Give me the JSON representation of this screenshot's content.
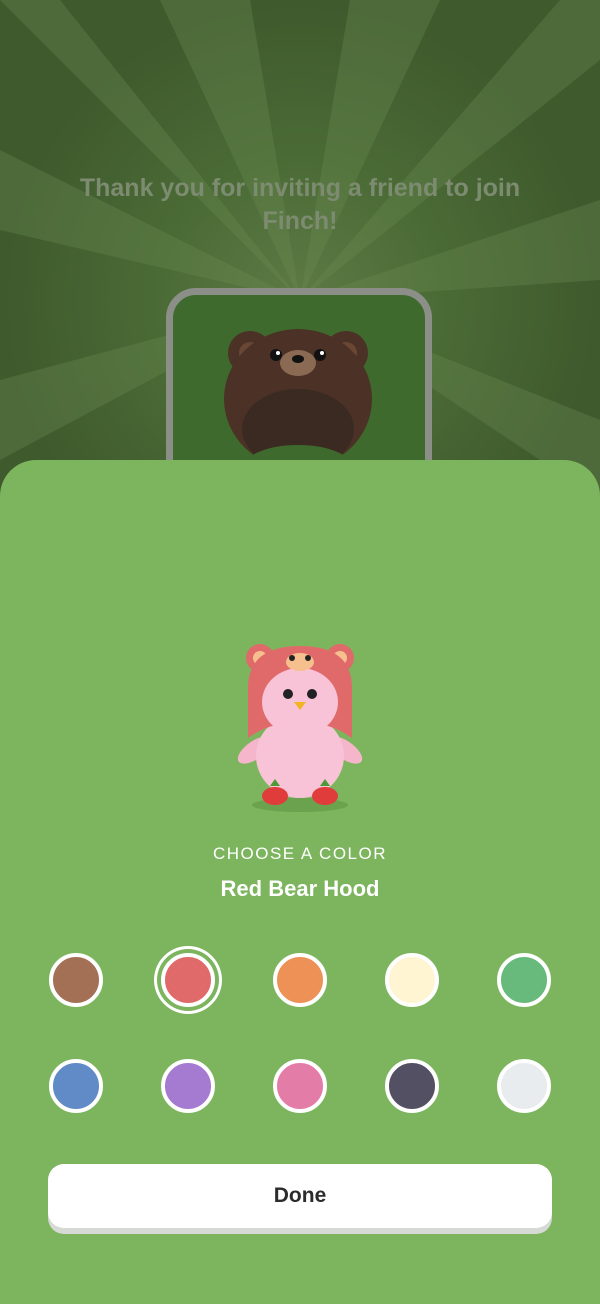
{
  "header": {
    "message": "Thank you for inviting a friend to join Finch!"
  },
  "colors": {
    "sheet_background": "#7cb55d",
    "backdrop": "#3f5a2d",
    "button_background": "#ffffff"
  },
  "picker": {
    "section_label": "CHOOSE A COLOR",
    "selected_item": "Red Bear Hood",
    "selected_index": 1,
    "swatches": [
      {
        "name": "brown",
        "color": "#a47055"
      },
      {
        "name": "red",
        "color": "#e06a6a"
      },
      {
        "name": "orange",
        "color": "#ee9156"
      },
      {
        "name": "cream",
        "color": "#fff5d3"
      },
      {
        "name": "green",
        "color": "#68b97c"
      },
      {
        "name": "blue",
        "color": "#618bc6"
      },
      {
        "name": "purple",
        "color": "#a57ad1"
      },
      {
        "name": "pink",
        "color": "#e47ca8"
      },
      {
        "name": "charcoal",
        "color": "#545064"
      },
      {
        "name": "light-gray",
        "color": "#e8ecee"
      }
    ]
  },
  "actions": {
    "done_label": "Done"
  },
  "icons": {
    "reward_preview": "brown-bear-hood-icon",
    "pet_preview": "pet-bird-red-bear-hood-icon"
  }
}
